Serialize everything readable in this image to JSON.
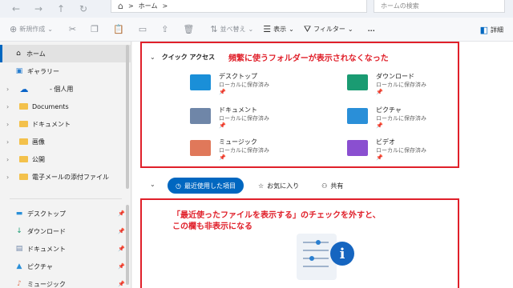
{
  "address": {
    "location": "ホーム",
    "separator": ">"
  },
  "search": {
    "placeholder": "ホームの検索"
  },
  "toolbar": {
    "new_label": "新規作成",
    "sort_label": "並べ替え",
    "view_label": "表示",
    "filter_label": "フィルター",
    "more_label": "...",
    "details_label": "詳細"
  },
  "sidebar": {
    "home": "ホーム",
    "gallery": "ギャラリー",
    "onedrive": "- 個人用",
    "folders": [
      "Documents",
      "ドキュメント",
      "画像",
      "公開",
      "電子メールの添付ファイル"
    ],
    "pinned": [
      "デスクトップ",
      "ダウンロード",
      "ドキュメント",
      "ピクチャ",
      "ミュージック"
    ]
  },
  "quick_access": {
    "title": "クイック アクセス",
    "items": [
      {
        "name": "デスクトップ",
        "sub": "ローカルに保存済み",
        "color": "#1a8fd8"
      },
      {
        "name": "ダウンロード",
        "sub": "ローカルに保存済み",
        "color": "#1a9b72"
      },
      {
        "name": "ドキュメント",
        "sub": "ローカルに保存済み",
        "color": "#6f86a8"
      },
      {
        "name": "ピクチャ",
        "sub": "ローカルに保存済み",
        "color": "#2a8fd8"
      },
      {
        "name": "ミュージック",
        "sub": "ローカルに保存済み",
        "color": "#e0785a"
      },
      {
        "name": "ビデオ",
        "sub": "ローカルに保存済み",
        "color": "#8a4fd0"
      }
    ]
  },
  "annotations": {
    "top": "頻繁に使うフォルダーが表示されなくなった",
    "bottom_line1": "「最近使ったファイルを表示する」のチェックを外すと、",
    "bottom_line2": "この欄も非表示になる"
  },
  "tabs": {
    "recent": "最近使用した項目",
    "favorites": "お気に入り",
    "shared": "共有"
  },
  "colors": {
    "accent": "#0067c0",
    "callout": "#e0202a"
  }
}
